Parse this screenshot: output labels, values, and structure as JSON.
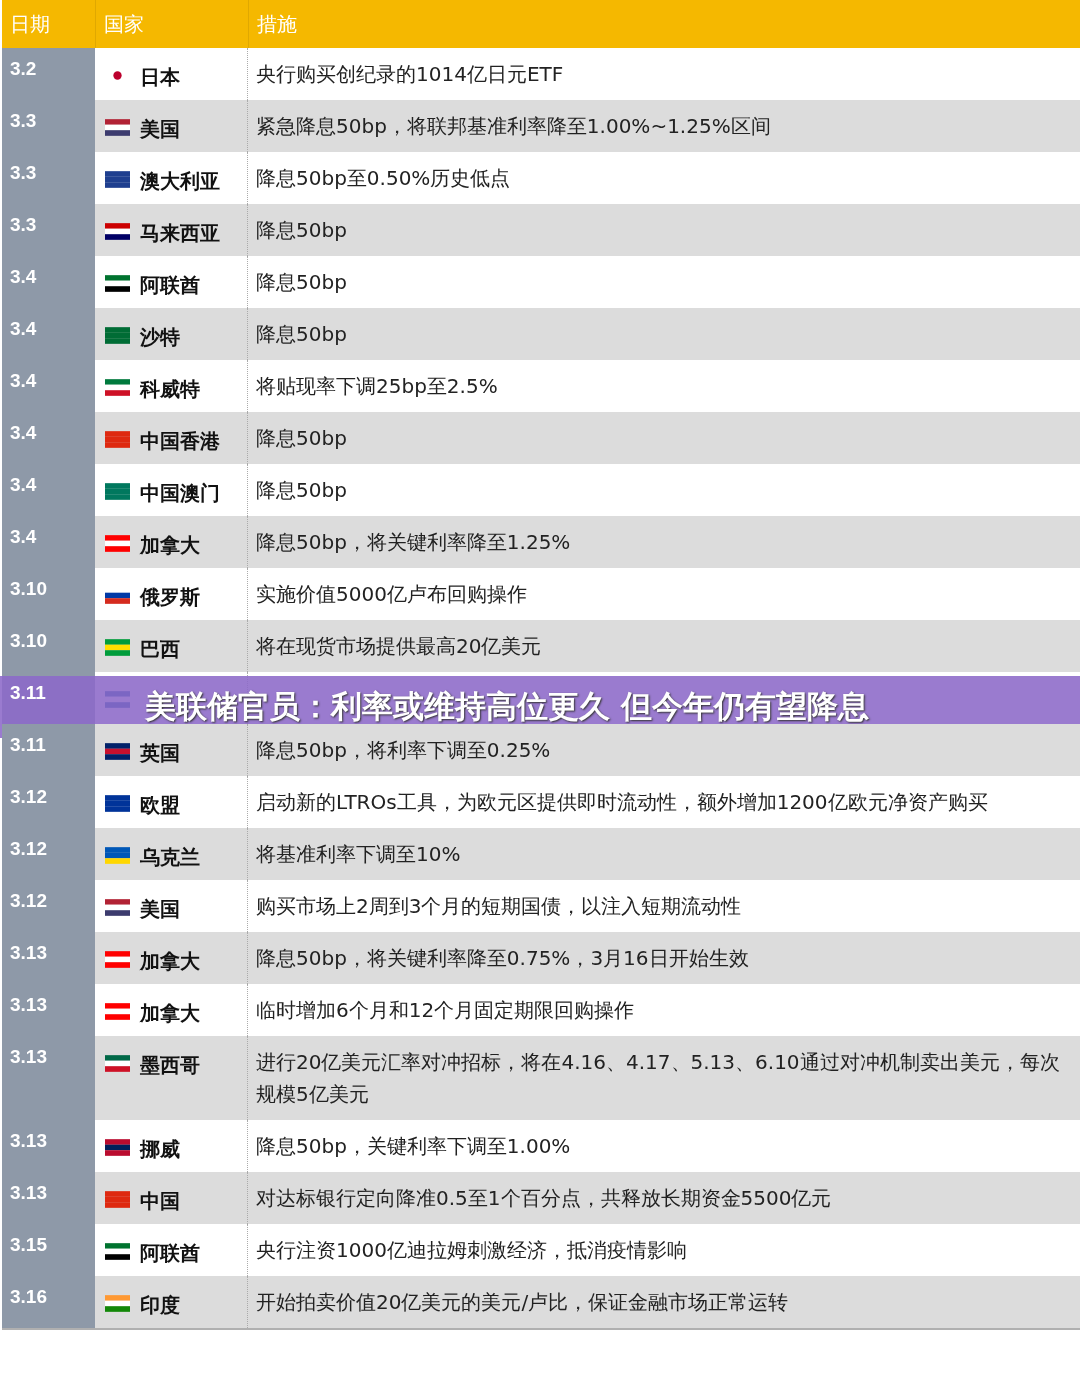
{
  "table": {
    "columns": [
      "日期",
      "国家",
      "措施"
    ],
    "rows": [
      {
        "date": "3.2",
        "country": "日本",
        "measure": "央行购买创纪录的1014亿日元ETF"
      },
      {
        "date": "3.3",
        "country": "美国",
        "measure": "紧急降息50bp，将联邦基准利率降至1.00%~1.25%区间"
      },
      {
        "date": "3.3",
        "country": "澳大利亚",
        "measure": "降息50bp至0.50%历史低点"
      },
      {
        "date": "3.3",
        "country": "马来西亚",
        "measure": "降息50bp"
      },
      {
        "date": "3.4",
        "country": "阿联酋",
        "measure": "降息50bp"
      },
      {
        "date": "3.4",
        "country": "沙特",
        "measure": "降息50bp"
      },
      {
        "date": "3.4",
        "country": "科威特",
        "measure": "将贴现率下调25bp至2.5%"
      },
      {
        "date": "3.4",
        "country": "中国香港",
        "measure": "降息50bp"
      },
      {
        "date": "3.4",
        "country": "中国澳门",
        "measure": "降息50bp"
      },
      {
        "date": "3.4",
        "country": "加拿大",
        "measure": "降息50bp，将关键利率降至1.25%"
      },
      {
        "date": "3.10",
        "country": "俄罗斯",
        "measure": "实施价值5000亿卢布回购操作"
      },
      {
        "date": "3.10",
        "country": "巴西",
        "measure": "将在现货市场提供最高20亿美元"
      },
      {
        "date": "3.11"
      },
      {
        "date": "3.11",
        "country": "英国",
        "measure": "降息50bp，将利率下调至0.25%"
      },
      {
        "date": "3.12",
        "country": "欧盟",
        "measure": "启动新的LTROs工具，为欧元区提供即时流动性，额外增加1200亿欧元净资产购买"
      },
      {
        "date": "3.12",
        "country": "乌克兰",
        "measure": "将基准利率下调至10%"
      },
      {
        "date": "3.12",
        "country": "美国",
        "measure": "购买市场上2周到3个月的短期国债，以注入短期流动性"
      },
      {
        "date": "3.13",
        "country": "加拿大",
        "measure": "降息50bp，将关键利率降至0.75%，3月16日开始生效"
      },
      {
        "date": "3.13",
        "country": "加拿大",
        "measure": "临时增加6个月和12个月固定期限回购操作"
      },
      {
        "date": "3.13",
        "country": "墨西哥",
        "measure": "进行20亿美元汇率对冲招标，将在4.16、4.17、5.13、6.10通过对冲机制卖出美元，每次规模5亿美元"
      },
      {
        "date": "3.13",
        "country": "挪威",
        "measure": "降息50bp，关键利率下调至1.00%"
      },
      {
        "date": "3.13",
        "country": "中国",
        "measure": "对达标银行定向降准0.5至1个百分点，共释放长期资金5500亿元"
      },
      {
        "date": "3.15",
        "country": "阿联酋",
        "measure": "央行注资1000亿迪拉姆刺激经济，抵消疫情影响"
      },
      {
        "date": "3.16",
        "country": "印度",
        "measure": "开始拍卖价值20亿美元的美元/卢比，保证金融市场正常运转"
      }
    ]
  },
  "banner": {
    "title": "美联储官员：利率或维持高位更久 但今年仍有望降息"
  }
}
